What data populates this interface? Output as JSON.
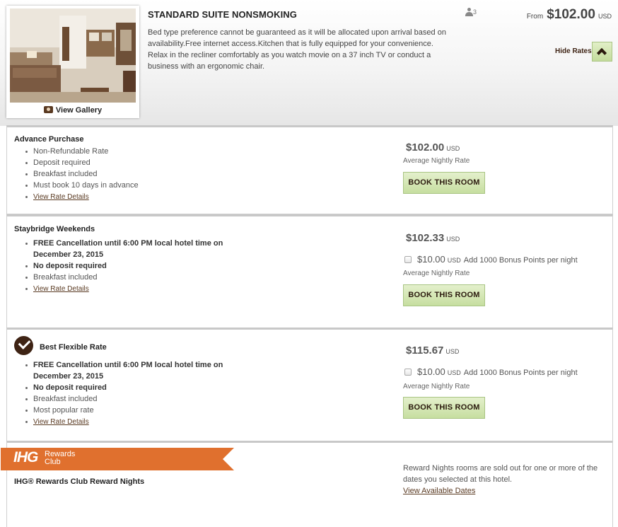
{
  "room": {
    "title": "STANDARD SUITE NONSMOKING",
    "description": "Bed type preference cannot be guaranteed as it will be allocated upon arrival based on availability.Free internet access.Kitchen that is fully equipped for your convenience. Relax in the recliner comfortably as you watch movie on a 37 inch TV or conduct a business with an ergonomic chair.",
    "view_gallery": "View Gallery",
    "max_occupancy": "3",
    "from_label": "From",
    "from_price": "$102.00",
    "currency": "USD",
    "hide_rates_label": "Hide Rates"
  },
  "rates": [
    {
      "name": "Advance Purchase",
      "items": [
        "Non-Refundable Rate",
        "Deposit required",
        "Breakfast included",
        "Must book 10 days in advance"
      ],
      "view_details": "View Rate Details",
      "price": "$102.00",
      "currency": "USD",
      "avg_label": "Average Nightly Rate",
      "book_label": "BOOK THIS ROOM"
    },
    {
      "name": "Staybridge Weekends",
      "items": [
        "FREE Cancellation until 6:00 PM local hotel time on December 23, 2015",
        "No deposit required",
        "Breakfast included"
      ],
      "view_details": "View Rate Details",
      "price": "$102.33",
      "currency": "USD",
      "bonus_price": "$10.00",
      "bonus_currency": "USD",
      "bonus_text": "Add 1000 Bonus Points per night",
      "avg_label": "Average Nightly Rate",
      "book_label": "BOOK THIS ROOM"
    },
    {
      "name": "Best Flexible Rate",
      "items": [
        "FREE Cancellation until 6:00 PM local hotel time on December 23, 2015",
        "No deposit required",
        "Breakfast included",
        "Most popular rate"
      ],
      "view_details": "View Rate Details",
      "price": "$115.67",
      "currency": "USD",
      "bonus_price": "$10.00",
      "bonus_currency": "USD",
      "bonus_text": "Add 1000 Bonus Points per night",
      "avg_label": "Average Nightly Rate",
      "book_label": "BOOK THIS ROOM"
    }
  ],
  "reward": {
    "logo_text": "IHG",
    "rewards_line1": "Rewards",
    "rewards_line2": "Club",
    "title": "IHG® Rewards Club Reward Nights",
    "sold_out_text": "Reward Nights rooms are sold out for one or more of the dates you selected at this hotel.",
    "view_dates": "View Available Dates"
  },
  "colors": {
    "brand_orange": "#e0702e",
    "dark_brown": "#3e2314",
    "button_green": "#c6dea0"
  }
}
